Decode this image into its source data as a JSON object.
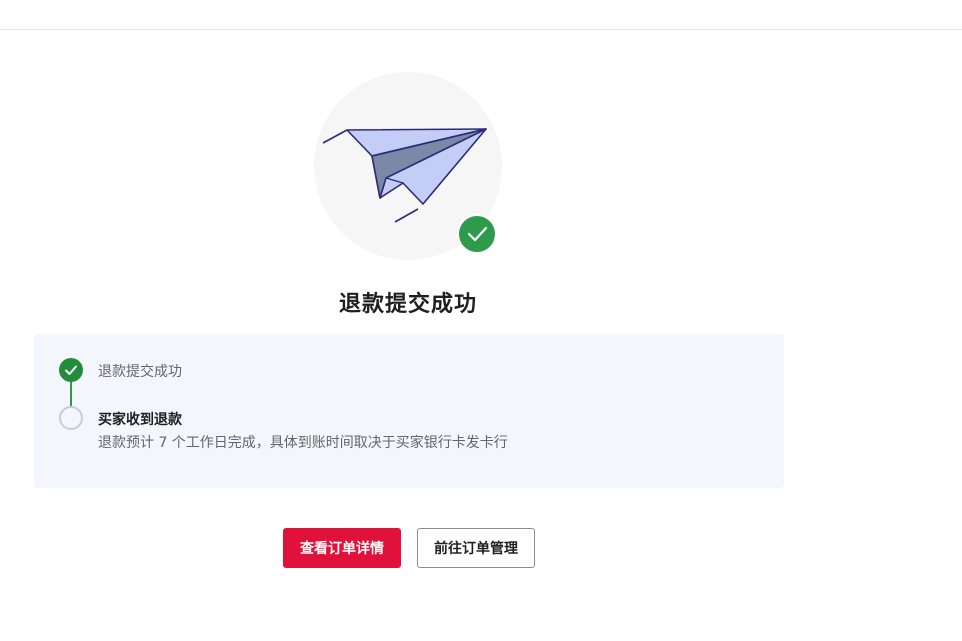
{
  "result": {
    "title": "退款提交成功",
    "illustration": "paper-plane-icon",
    "badge_icon": "check-icon"
  },
  "steps": [
    {
      "label": "退款提交成功",
      "status": "done",
      "icon": "check-icon"
    },
    {
      "label": "买家收到退款",
      "status": "pending",
      "description": "退款预计 7 个工作日完成，具体到账时间取决于买家银行卡发卡行"
    }
  ],
  "actions": {
    "view_order_detail": "查看订单详情",
    "go_order_management": "前往订单管理"
  },
  "colors": {
    "primary": "#e0123c",
    "success": "#2e9a4b",
    "panel_bg": "#f4f6fd"
  }
}
